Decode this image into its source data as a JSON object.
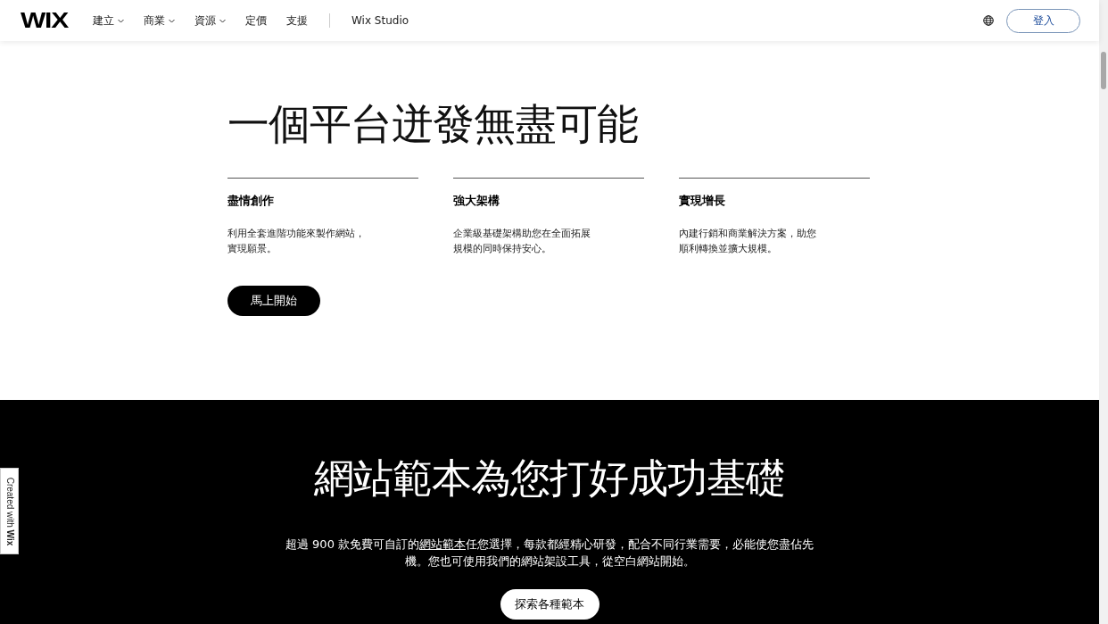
{
  "header": {
    "logo": "WIX",
    "nav": [
      {
        "label": "建立",
        "has_menu": true
      },
      {
        "label": "商業",
        "has_menu": true
      },
      {
        "label": "資源",
        "has_menu": true
      },
      {
        "label": "定價",
        "has_menu": false
      },
      {
        "label": "支援",
        "has_menu": false
      }
    ],
    "studio_link": "Wix Studio",
    "login": "登入"
  },
  "hero": {
    "title": "一個平台迸發無盡可能",
    "features": [
      {
        "title": "盡情創作",
        "text": "利用全套進階功能來製作網站，實現願景。"
      },
      {
        "title": "強大架構",
        "text": "企業級基礎架構助您在全面拓展規模的同時保持安心。"
      },
      {
        "title": "實現增長",
        "text": "內建行銷和商業解決方案，助您順利轉換並擴大規模。"
      }
    ],
    "cta": "馬上開始"
  },
  "templates": {
    "title": "網站範本為您打好成功基礎",
    "text_before": "超過 900 款免費可自訂的",
    "link": "網站範本",
    "text_after": "任您選擇，每款都經精心研發，配合不同行業需要，必能使您盡佔先機。您也可使用我們的網站架設工具，從空白網站開始。",
    "button": "探索各種範本"
  },
  "badge": "Created with **Wix**"
}
